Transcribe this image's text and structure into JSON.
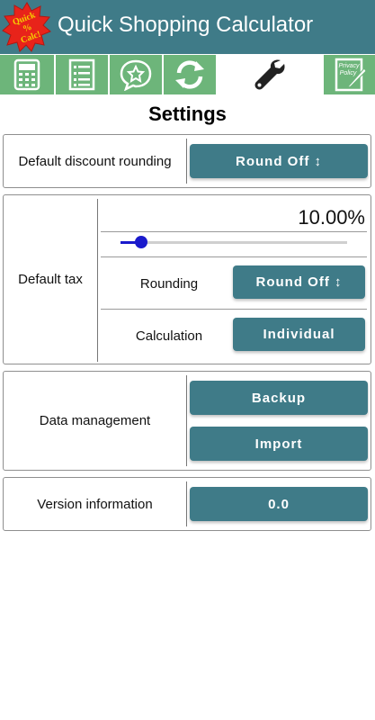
{
  "app": {
    "title": "Quick Shopping Calculator",
    "logo_text": [
      "Quick",
      "%",
      "Calc!"
    ],
    "colors": {
      "primary": "#3f7b88",
      "tab_bg": "#6db57a",
      "badge": "#e8231a",
      "badge_text": "#f5d000",
      "slider": "#1a1acc"
    }
  },
  "tabs": [
    {
      "icon": "calculator-icon",
      "active": false
    },
    {
      "icon": "list-icon",
      "active": false
    },
    {
      "icon": "star-chat-icon",
      "active": false
    },
    {
      "icon": "refresh-icon",
      "active": false
    },
    {
      "icon": "wrench-icon",
      "active": true
    },
    {
      "icon": "privacy-policy-icon",
      "label": "Privacy Policy",
      "active": false
    }
  ],
  "page": {
    "title": "Settings"
  },
  "discount": {
    "label": "Default discount rounding",
    "button": "Round Off ↕"
  },
  "tax": {
    "label": "Default tax",
    "value": "10.00%",
    "slider_fraction": 0.09,
    "rounding_label": "Rounding",
    "rounding_button": "Round Off ↕",
    "calculation_label": "Calculation",
    "calculation_button": "Individual"
  },
  "data_management": {
    "label": "Data management",
    "backup_button": "Backup",
    "import_button": "Import"
  },
  "version": {
    "label": "Version information",
    "value": "0.0"
  }
}
